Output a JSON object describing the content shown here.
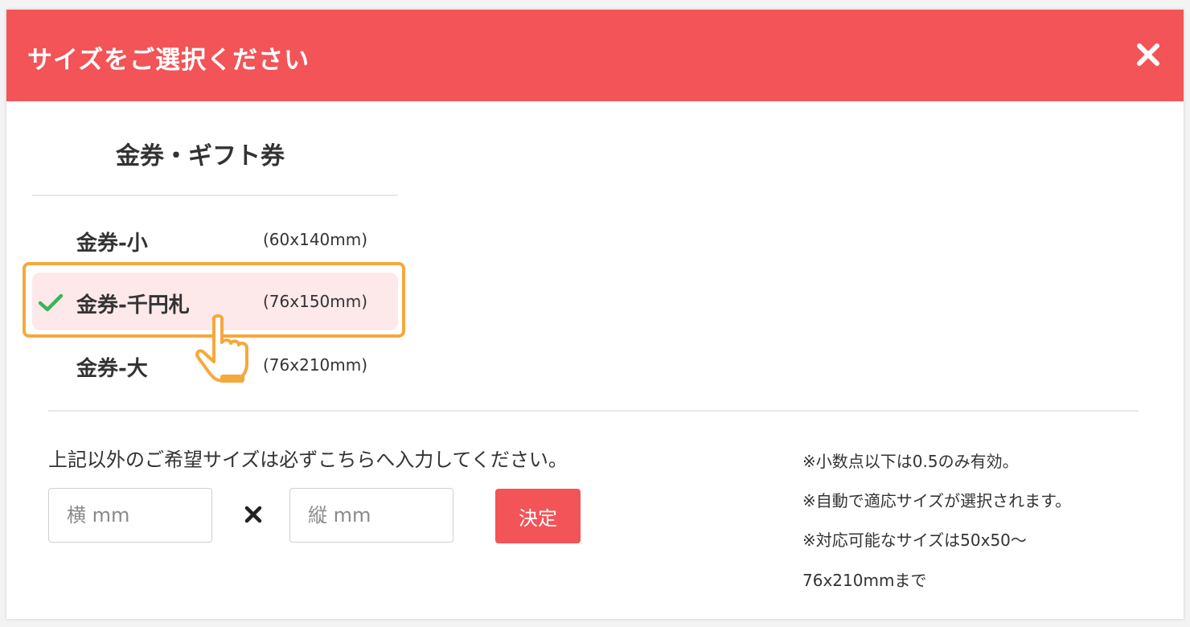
{
  "header": {
    "title": "サイズをご選択ください",
    "close_icon": "close-icon",
    "color": "#f25457"
  },
  "category": {
    "title": "金券・ギフト券"
  },
  "sizes": [
    {
      "name": "金券-小",
      "dims": "(60x140mm)",
      "selected": false
    },
    {
      "name": "金券-千円札",
      "dims": "(76x150mm)",
      "selected": true
    },
    {
      "name": "金券-大",
      "dims": "(76x210mm)",
      "selected": false
    }
  ],
  "custom": {
    "instruction": "上記以外のご希望サイズは必ずこちらへ入力してください。",
    "width_placeholder": "横 mm",
    "height_placeholder": "縦 mm",
    "times_icon": "multiply-icon",
    "submit_label": "決定"
  },
  "notes": [
    "※小数点以下は0.5のみ有効。",
    "※自動で適応サイズが選択されます。",
    "※対応可能なサイズは50x50～",
    "76x210mmまで"
  ],
  "colors": {
    "accent": "#f25457",
    "highlight": "#f5a83c",
    "selected_bg": "#fde8ea",
    "check": "#3cb45a"
  }
}
